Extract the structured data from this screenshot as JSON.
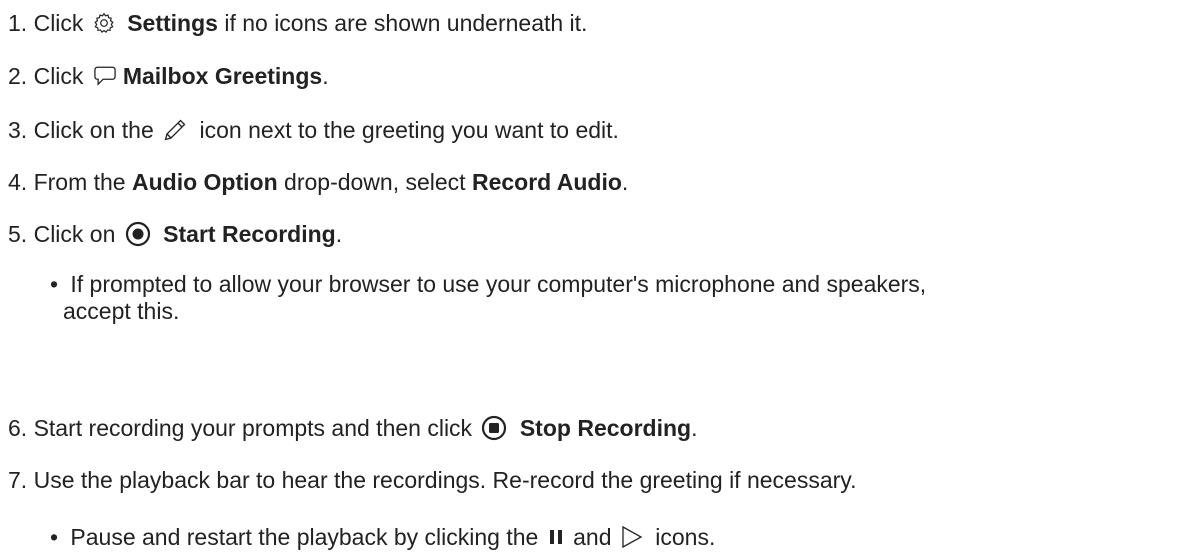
{
  "steps": [
    {
      "num": "1.",
      "pre": "Click",
      "bold": "Settings",
      "post": "if no icons are shown underneath it.",
      "icon": "gear-icon"
    },
    {
      "num": "2.",
      "pre": "Click",
      "bold": "Mailbox Greetings",
      "post": ".",
      "icon": "speech-bubble-icon"
    },
    {
      "num": "3.",
      "pre": "Click on the",
      "post": "icon next to the greeting you want to edit.",
      "icon": "pencil-icon"
    },
    {
      "num": "4.",
      "pre": "From the",
      "bold1": "Audio Option",
      "mid": "drop-down, select",
      "bold2": "Record Audio",
      "post": "."
    },
    {
      "num": "5.",
      "pre": "Click on",
      "bold": "Start Recording",
      "post": ".",
      "icon": "record-icon"
    },
    {
      "num": "6.",
      "pre": "Start recording your prompts and then click",
      "bold": "Stop Recording",
      "post": ".",
      "icon": "stop-icon"
    },
    {
      "num": "7.",
      "text": "Use the playback bar to hear the recordings. Re-record the greeting if necessary."
    }
  ],
  "bullets": {
    "b1_line1": "If prompted to allow your browser to use your computer's microphone and speakers,",
    "b1_line2": "accept this.",
    "b2_pre": "Pause and restart the playback by clicking the",
    "b2_mid": "and",
    "b2_post": "icons.",
    "b2_icons": [
      "pause-icon",
      "play-icon"
    ]
  },
  "bullet_char": "•"
}
